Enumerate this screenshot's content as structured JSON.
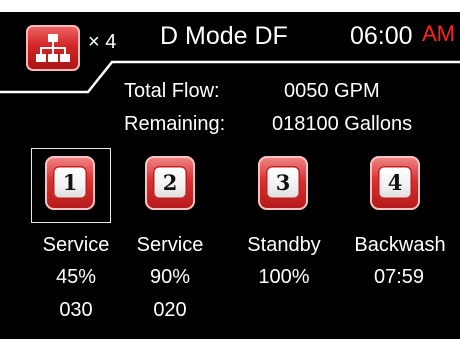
{
  "header": {
    "units_multiplier": "× 4",
    "mode": "D Mode  DF",
    "time": "06:00",
    "ampm": "AM"
  },
  "info": {
    "total_flow_label": "Total Flow:",
    "total_flow_value": "0050 GPM",
    "remaining_label": "Remaining:",
    "remaining_value": "018100 Gallons"
  },
  "units": [
    {
      "number": "1",
      "status": "Service",
      "percent": "45%",
      "code": "030",
      "selected": true
    },
    {
      "number": "2",
      "status": "Service",
      "percent": "90%",
      "code": "020",
      "selected": false
    },
    {
      "number": "3",
      "status": "Standby",
      "percent": "100%",
      "code": "",
      "selected": false
    },
    {
      "number": "4",
      "status": "Backwash",
      "percent": "07:59",
      "code": "",
      "selected": false
    }
  ],
  "icons": {
    "network": "network-icon"
  },
  "colors": {
    "background": "#000000",
    "text": "#ffffff",
    "accent": "#d42525",
    "ampm": "#ff2222"
  }
}
